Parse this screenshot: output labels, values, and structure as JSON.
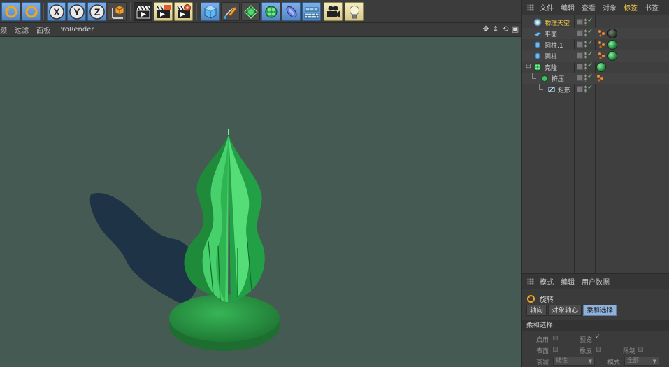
{
  "toolbar": {
    "buttons": [
      {
        "icon": "undo-rotate-icon"
      },
      {
        "icon": "redo-rotate-icon"
      },
      {
        "icon": "x-axis-lock-icon",
        "label": "X"
      },
      {
        "icon": "y-axis-lock-icon",
        "label": "Y"
      },
      {
        "icon": "z-axis-lock-icon",
        "label": "Z"
      },
      {
        "icon": "coordinate-system-icon"
      },
      {
        "icon": "render-view-icon"
      },
      {
        "icon": "render-picture-viewer-icon"
      },
      {
        "icon": "render-settings-icon"
      },
      {
        "icon": "cube-primitive-icon"
      },
      {
        "icon": "pen-spline-icon"
      },
      {
        "icon": "subdivision-generator-icon"
      },
      {
        "icon": "cloner-mograph-icon"
      },
      {
        "icon": "deformer-icon"
      },
      {
        "icon": "floor-environment-icon"
      },
      {
        "icon": "camera-icon"
      },
      {
        "icon": "light-icon"
      }
    ]
  },
  "viewport": {
    "menu": [
      "频",
      "过滤",
      "面板",
      "ProRender"
    ],
    "background": "#455a53",
    "object_color": "#2bbf55"
  },
  "object_manager": {
    "menu": [
      "文件",
      "编辑",
      "查看",
      "对象",
      "标签",
      "书签"
    ],
    "active_menu": "标签",
    "objects": [
      {
        "name": "物理天空",
        "icon": "physical-sky-icon",
        "highlight": true,
        "tags": [
          "render-tag-icon"
        ]
      },
      {
        "name": "平面",
        "icon": "plane-icon",
        "tags": [
          "phong-tag-icon",
          "material-dark-icon"
        ]
      },
      {
        "name": "圆柱.1",
        "icon": "cylinder-icon",
        "tags": [
          "phong-tag-icon",
          "material-green-icon"
        ]
      },
      {
        "name": "圆柱",
        "icon": "cylinder-icon",
        "tags": [
          "phong-tag-icon",
          "material-green-icon"
        ]
      },
      {
        "name": "克隆",
        "icon": "cloner-icon",
        "tags": [
          "material-green-icon"
        ]
      },
      {
        "name": "挤压",
        "icon": "extrude-icon",
        "tags": [
          "phong-tag-icon"
        ]
      },
      {
        "name": "矩形",
        "icon": "rectangle-spline-icon",
        "tags": []
      }
    ]
  },
  "attributes": {
    "menu": [
      "模式",
      "编辑",
      "用户数据"
    ],
    "title": "旋转",
    "tabs": [
      "轴向",
      "对象轴心",
      "柔和选择"
    ],
    "active_tab": "柔和选择",
    "section": "柔和选择",
    "fields": {
      "enable": "启用",
      "preview": "预览",
      "surface": "表面",
      "rubber": "橡皮",
      "restrict": "限制",
      "falloff_label": "衰减",
      "falloff_value": "线性",
      "mode_label": "模式",
      "mode_value": "全部"
    }
  }
}
